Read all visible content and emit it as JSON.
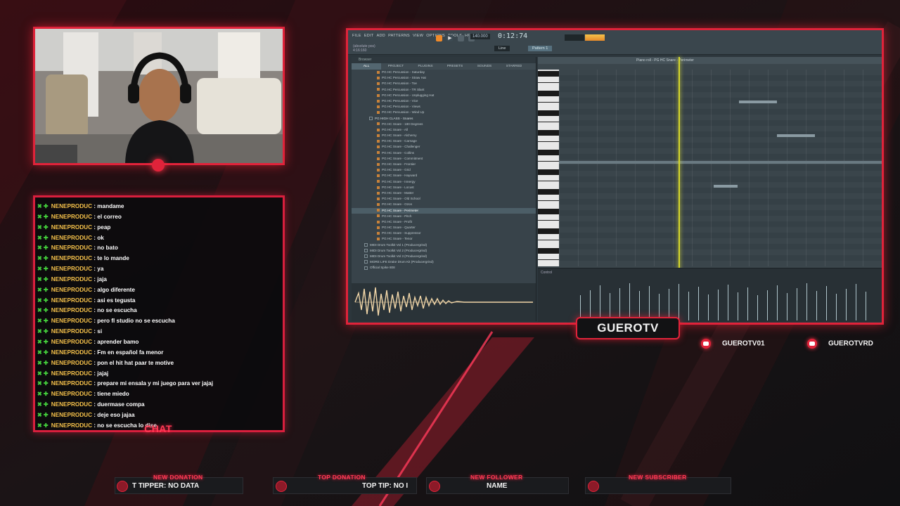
{
  "colors": {
    "accent": "#e0233a",
    "chat_user": "#f4c04a",
    "badge": "#44d03c",
    "playhead": "#d4d62a"
  },
  "chat": {
    "label": "CHAT",
    "messages": [
      {
        "user": "NENEPRODUC",
        "text": "mandame"
      },
      {
        "user": "NENEPRODUC",
        "text": "el correo"
      },
      {
        "user": "NENEPRODUC",
        "text": "peap"
      },
      {
        "user": "NENEPRODUC",
        "text": "ok"
      },
      {
        "user": "NENEPRODUC",
        "text": "no bato"
      },
      {
        "user": "NENEPRODUC",
        "text": "te lo mande"
      },
      {
        "user": "NENEPRODUC",
        "text": "ya"
      },
      {
        "user": "NENEPRODUC",
        "text": "jaja"
      },
      {
        "user": "NENEPRODUC",
        "text": "algo diferente"
      },
      {
        "user": "NENEPRODUC",
        "text": "asi es tegusta"
      },
      {
        "user": "NENEPRODUC",
        "text": "no se escucha"
      },
      {
        "user": "NENEPRODUC",
        "text": "pero fl studio no se escucha"
      },
      {
        "user": "NENEPRODUC",
        "text": "si"
      },
      {
        "user": "NENEPRODUC",
        "text": "aprender bamo"
      },
      {
        "user": "NENEPRODUC",
        "text": "Fm en español fa menor"
      },
      {
        "user": "NENEPRODUC",
        "text": "pon el hit hat paar te motive"
      },
      {
        "user": "NENEPRODUC",
        "text": "jajaj"
      },
      {
        "user": "NENEPRODUC",
        "text": "prepare mi ensala y mi juego para ver jajaj"
      },
      {
        "user": "NENEPRODUC",
        "text": "tiene miedo"
      },
      {
        "user": "NENEPRODUC",
        "text": "duermase compa"
      },
      {
        "user": "NENEPRODUC",
        "text": "deje eso jajaa"
      },
      {
        "user": "NENEPRODUC",
        "text": "no se escucha lo dise"
      }
    ]
  },
  "daw": {
    "menu": [
      "FILE",
      "EDIT",
      "ADD",
      "PATTERNS",
      "VIEW",
      "OPTIONS",
      "TOOLS",
      "HELP"
    ],
    "time": "0:12:74",
    "tempo": "140.000",
    "pattern": "Pattern 1",
    "line_mode": "Line",
    "info_left": [
      "(absolute pos)",
      "4:16:160"
    ],
    "browser_title": "Browser",
    "browser_tabs": [
      "ALL",
      "PROJECT",
      "PLUGINS",
      "PRESETS",
      "SOUNDS",
      "STARRED"
    ],
    "browser_items": [
      {
        "label": "PG HC Percussion - Saturday",
        "kind": "file"
      },
      {
        "label": "PG HC Percussion - Straw Hat",
        "kind": "file"
      },
      {
        "label": "PG HC Percussion - Toe",
        "kind": "file"
      },
      {
        "label": "PG HC Percussion - TR Slant",
        "kind": "file"
      },
      {
        "label": "PG HC Percussion - Unplugging Hat",
        "kind": "file"
      },
      {
        "label": "PG HC Percussion - Vice",
        "kind": "file"
      },
      {
        "label": "PG HC Percussion - Views",
        "kind": "file"
      },
      {
        "label": "PG HC Percussion - Wind Up",
        "kind": "file"
      },
      {
        "label": "PG HIGH CLASS - Snares",
        "kind": "folder"
      },
      {
        "label": "PG HC Snare - 180 Degrees",
        "kind": "file"
      },
      {
        "label": "PG HC Snare - All",
        "kind": "file"
      },
      {
        "label": "PG HC Snare - Alchemy",
        "kind": "file"
      },
      {
        "label": "PG HC Snare - Carnage",
        "kind": "file"
      },
      {
        "label": "PG HC Snare - Challenger",
        "kind": "file"
      },
      {
        "label": "PG HC Snare - Collins",
        "kind": "file"
      },
      {
        "label": "PG HC Snare - Commitment",
        "kind": "file"
      },
      {
        "label": "PG HC Snare - Frontier",
        "kind": "file"
      },
      {
        "label": "PG HC Snare - Grid",
        "kind": "file"
      },
      {
        "label": "PG HC Snare - Hayward",
        "kind": "file"
      },
      {
        "label": "PG HC Snare - Innergy",
        "kind": "file"
      },
      {
        "label": "PG HC Snare - Locust",
        "kind": "file"
      },
      {
        "label": "PG HC Snare - Matter",
        "kind": "file"
      },
      {
        "label": "PG HC Snare - Old School",
        "kind": "file"
      },
      {
        "label": "PG HC Snare - Ozon",
        "kind": "file"
      },
      {
        "label": "PG HC Snare - Perimeter",
        "kind": "selected"
      },
      {
        "label": "PG HC Snare - Pitch",
        "kind": "file"
      },
      {
        "label": "PG HC Snare - Profit",
        "kind": "file"
      },
      {
        "label": "PG HC Snare - Quarter",
        "kind": "file"
      },
      {
        "label": "PG HC Snare - Suppressor",
        "kind": "file"
      },
      {
        "label": "PG HC Snare - Tenor",
        "kind": "file"
      },
      {
        "label": "MIDI Drum Toolkit Vol 1 (Producergrind)",
        "kind": "sub"
      },
      {
        "label": "MIDI Drum Toolkit Vol 2 (Producergrind)",
        "kind": "sub"
      },
      {
        "label": "MIDI Drum Toolkit Vol 3 (Producergrind)",
        "kind": "sub"
      },
      {
        "label": "MORE LIFE Drake Drum Kit (Producergrind)",
        "kind": "sub"
      },
      {
        "label": "Official Spike 808",
        "kind": "sub"
      }
    ],
    "piano_roll_title": "Piano roll - PG HC Snare - Perimeter",
    "control_label": "Control"
  },
  "overlay": {
    "channel_name": "GUEROTV",
    "socials": [
      {
        "handle": "GUEROTV01",
        "icon": "youtube-icon"
      },
      {
        "handle": "GUEROTVRD",
        "icon": "youtube-icon"
      }
    ],
    "alerts": [
      {
        "title": "NEW DONATION",
        "text": "T TIPPER: NO DATA"
      },
      {
        "title": "TOP DONATION",
        "text": "TOP TIP: NO I"
      },
      {
        "title": "NEW FOLLOWER",
        "text": "NAME"
      },
      {
        "title": "NEW SUBSCRIBER",
        "text": ""
      }
    ]
  }
}
